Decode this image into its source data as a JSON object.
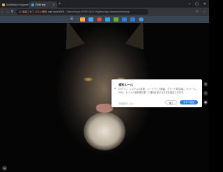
{
  "browser": {
    "tabs": [
      {
        "label": "DiskStation Support",
        "active": false,
        "favicon_color": "#e8a33d"
      },
      {
        "label": "DSM test",
        "active": true,
        "favicon_color": "#4a90e2"
      }
    ],
    "new_tab_glyph": "+",
    "window_controls": [
      "–",
      "▢",
      "✕"
    ],
    "nav_glyphs": {
      "back": "←",
      "forward": "→",
      "reload": "↻"
    },
    "address": {
      "warning": "⚠ 保護されていない通信",
      "host": "nas.local:5001",
      "path": "/?launchApp=SYNO.SDS.PkgManApp.Instance#/desktop"
    },
    "toolbar_icons": [
      "☆",
      "⋮"
    ]
  },
  "taskbar": {
    "colors": {
      "background": "#3a4554",
      "icons": [
        "#f5b52e",
        "#5b9bd5",
        "#e84c3d",
        "#3aa0e6",
        "#6aa84f",
        "#2e7dde",
        "#2e7dde",
        "#4a90e2"
      ]
    },
    "icons": [
      "main-menu-icon",
      "file-station-icon",
      "package-center-icon",
      "control-panel-icon",
      "photos-icon",
      "storage-icon",
      "download-icon",
      "support-icon"
    ]
  },
  "desktop": {
    "wallpaper": "lynx-portrait"
  },
  "rail_icons": [
    "≡",
    "◔",
    "◉"
  ],
  "dialog": {
    "title": "通知ルール",
    "body": "ログイン、システムの変更、ハードウェア障害、アラート発生時に、E メール、SMS、モバイル端末等を通じて通知を受ける方法を設定できます。",
    "link": "今後表示しない",
    "cancel_label": "後で",
    "primary_label": "今すぐ設定",
    "accent": "#2e7dde"
  },
  "bottom_badge": "N"
}
